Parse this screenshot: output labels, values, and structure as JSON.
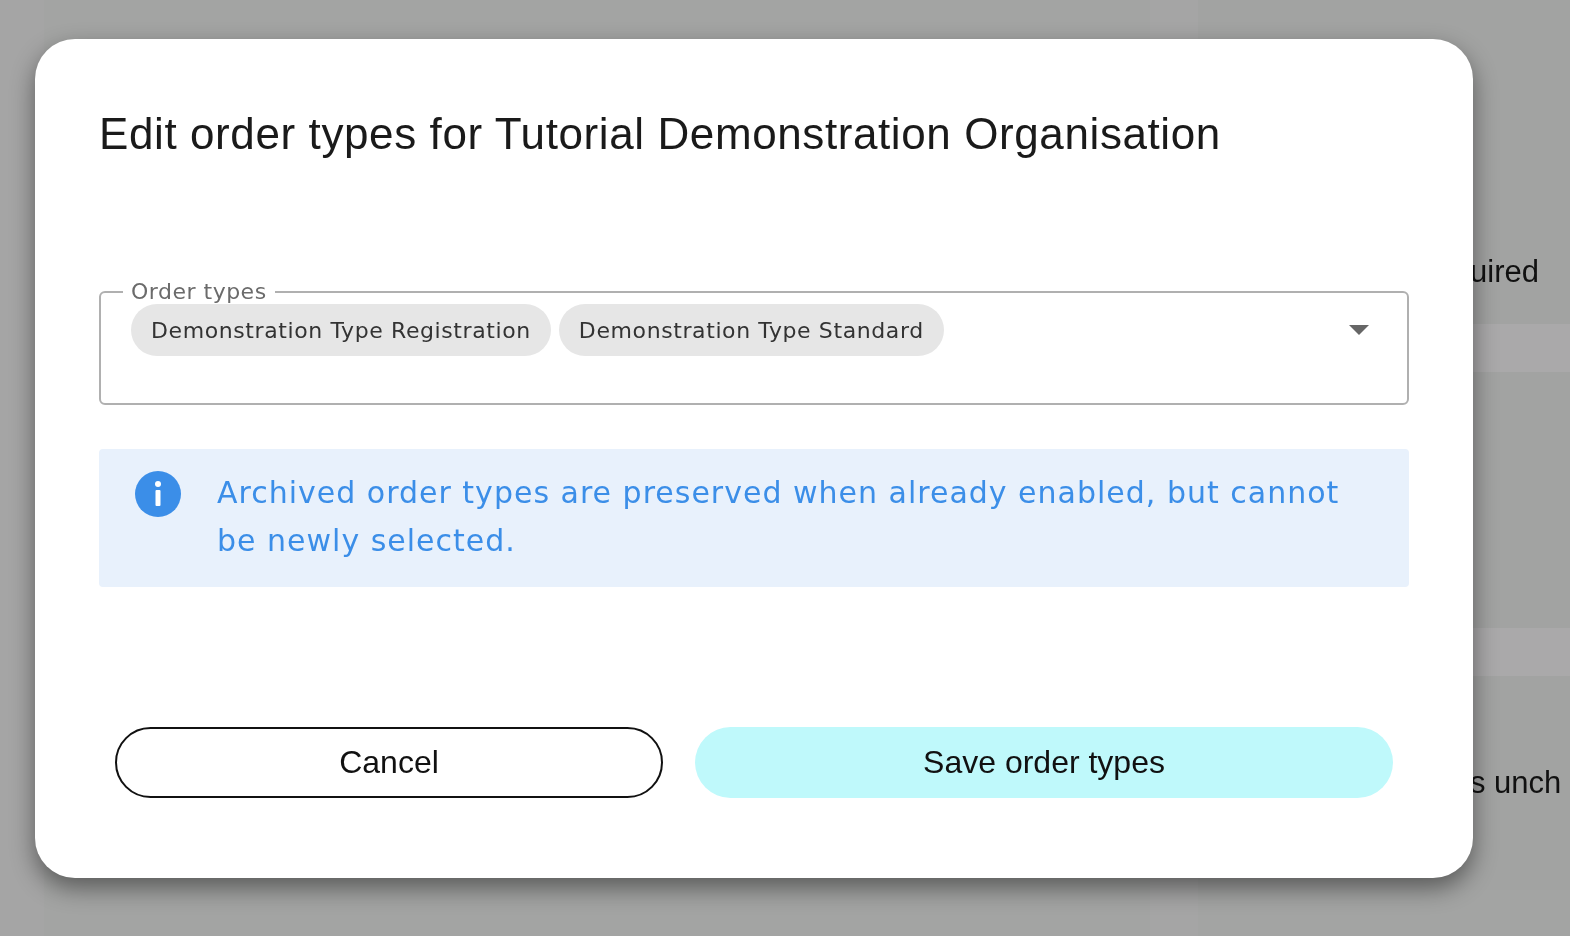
{
  "background": {
    "right_texts": [
      "uired",
      "s unch"
    ]
  },
  "dialog": {
    "title": "Edit order types for Tutorial Demonstration Organisation",
    "field": {
      "label": "Order types",
      "chips": [
        "Demonstration Type Registration",
        "Demonstration Type Standard"
      ]
    },
    "notice": "Archived order types are preserved when already enabled, but cannot be newly selected.",
    "buttons": [
      {
        "label": "Cancel",
        "kind": "secondary"
      },
      {
        "label": "Save order types",
        "kind": "primary"
      }
    ]
  }
}
